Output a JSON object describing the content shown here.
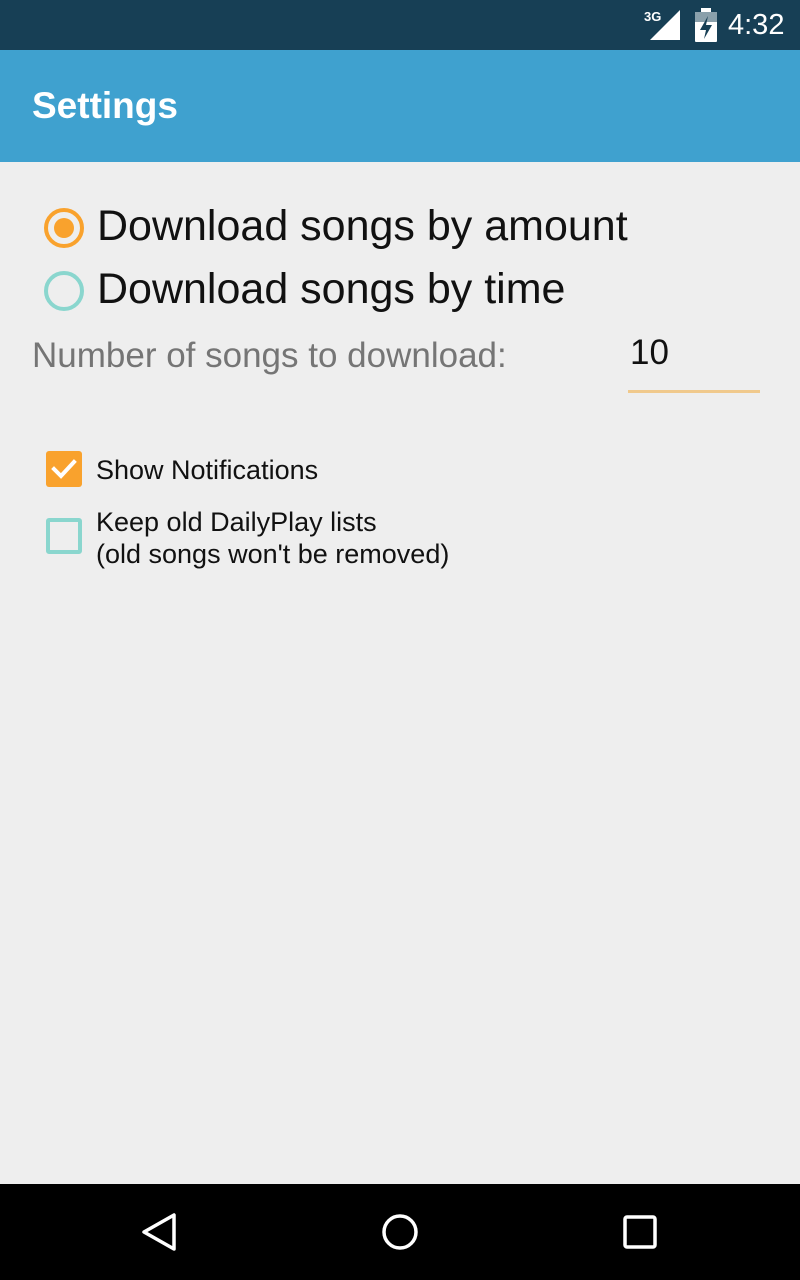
{
  "status_bar": {
    "network_label": "3G",
    "time": "4:32",
    "icons": [
      "signal-icon",
      "battery-charging-icon"
    ]
  },
  "app_bar": {
    "title": "Settings"
  },
  "download_mode": {
    "options": [
      {
        "label": "Download songs by amount",
        "selected": true
      },
      {
        "label": "Download songs by time",
        "selected": false
      }
    ]
  },
  "amount": {
    "label": "Number of songs to download:",
    "value": "10"
  },
  "preferences": [
    {
      "lines": [
        "Show Notifications"
      ],
      "checked": true
    },
    {
      "lines": [
        "Keep old DailyPlay lists",
        "(old songs won't be removed)"
      ],
      "checked": false
    }
  ],
  "nav_bar": {
    "buttons": [
      "back-icon",
      "home-icon",
      "recents-icon"
    ]
  },
  "colors": {
    "status_bar": "#173f55",
    "app_bar": "#3fa1cf",
    "accent": "#f9a22d",
    "unchecked": "#8ad6ce",
    "background": "#eeeeee"
  }
}
